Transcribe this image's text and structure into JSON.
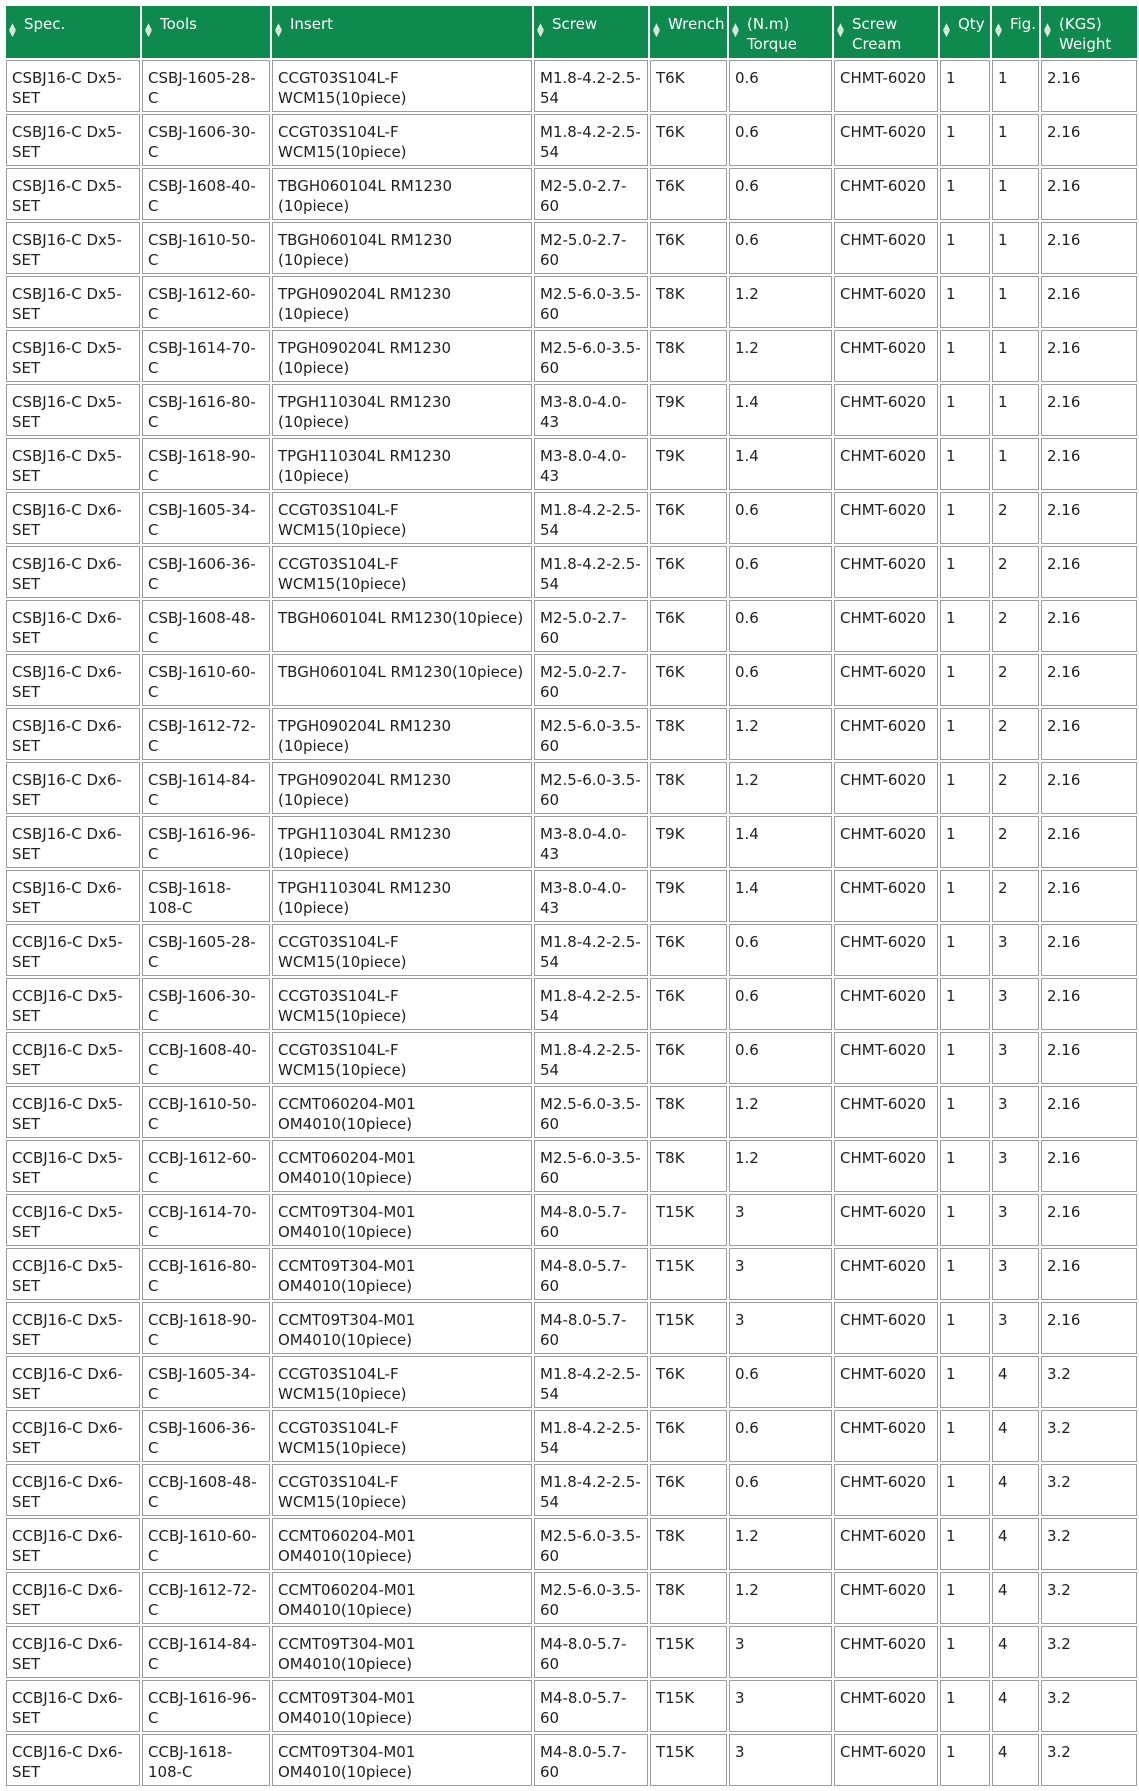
{
  "headers": [
    {
      "l1": "Spec.",
      "l2": ""
    },
    {
      "l1": "Tools",
      "l2": ""
    },
    {
      "l1": "Insert",
      "l2": ""
    },
    {
      "l1": "Screw",
      "l2": ""
    },
    {
      "l1": "Wrench",
      "l2": ""
    },
    {
      "l1": "(N.m)",
      "l2": "Torque"
    },
    {
      "l1": "Screw",
      "l2": "Cream"
    },
    {
      "l1": "Qty",
      "l2": ""
    },
    {
      "l1": "Fig.",
      "l2": ""
    },
    {
      "l1": "(KGS)",
      "l2": "Weight"
    }
  ],
  "rows": [
    [
      "CSBJ16-C Dx5-SET",
      "CSBJ-1605-28-C",
      "CCGT03S104L-F WCM15(10piece)",
      "M1.8-4.2-2.5-54",
      "T6K",
      "0.6",
      "CHMT-6020",
      "1",
      "1",
      "2.16"
    ],
    [
      "CSBJ16-C Dx5-SET",
      "CSBJ-1606-30-C",
      "CCGT03S104L-F WCM15(10piece)",
      "M1.8-4.2-2.5-54",
      "T6K",
      "0.6",
      "CHMT-6020",
      "1",
      "1",
      "2.16"
    ],
    [
      "CSBJ16-C Dx5-SET",
      "CSBJ-1608-40-C",
      "TBGH060104L RM1230 (10piece)",
      "M2-5.0-2.7-60",
      "T6K",
      "0.6",
      "CHMT-6020",
      "1",
      "1",
      "2.16"
    ],
    [
      "CSBJ16-C Dx5-SET",
      "CSBJ-1610-50-C",
      "TBGH060104L RM1230 (10piece)",
      "M2-5.0-2.7-60",
      "T6K",
      "0.6",
      "CHMT-6020",
      "1",
      "1",
      "2.16"
    ],
    [
      "CSBJ16-C Dx5-SET",
      "CSBJ-1612-60-C",
      "TPGH090204L RM1230 (10piece)",
      "M2.5-6.0-3.5-60",
      "T8K",
      "1.2",
      "CHMT-6020",
      "1",
      "1",
      "2.16"
    ],
    [
      "CSBJ16-C Dx5-SET",
      "CSBJ-1614-70-C",
      "TPGH090204L RM1230 (10piece)",
      "M2.5-6.0-3.5-60",
      "T8K",
      "1.2",
      "CHMT-6020",
      "1",
      "1",
      "2.16"
    ],
    [
      "CSBJ16-C Dx5-SET",
      "CSBJ-1616-80-C",
      "TPGH110304L RM1230 (10piece)",
      "M3-8.0-4.0-43",
      "T9K",
      "1.4",
      "CHMT-6020",
      "1",
      "1",
      "2.16"
    ],
    [
      "CSBJ16-C Dx5-SET",
      "CSBJ-1618-90-C",
      "TPGH110304L RM1230 (10piece)",
      "M3-8.0-4.0-43",
      "T9K",
      "1.4",
      "CHMT-6020",
      "1",
      "1",
      "2.16"
    ],
    [
      "CSBJ16-C Dx6-SET",
      "CSBJ-1605-34-C",
      "CCGT03S104L-F WCM15(10piece)",
      "M1.8-4.2-2.5-54",
      "T6K",
      "0.6",
      "CHMT-6020",
      "1",
      "2",
      "2.16"
    ],
    [
      "CSBJ16-C Dx6-SET",
      "CSBJ-1606-36-C",
      "CCGT03S104L-F WCM15(10piece)",
      "M1.8-4.2-2.5-54",
      "T6K",
      "0.6",
      "CHMT-6020",
      "1",
      "2",
      "2.16"
    ],
    [
      "CSBJ16-C Dx6-SET",
      "CSBJ-1608-48-C",
      "TBGH060104L RM1230(10piece)",
      "M2-5.0-2.7-60",
      "T6K",
      "0.6",
      "CHMT-6020",
      "1",
      "2",
      "2.16"
    ],
    [
      "CSBJ16-C Dx6-SET",
      "CSBJ-1610-60-C",
      "TBGH060104L RM1230(10piece)",
      "M2-5.0-2.7-60",
      "T6K",
      "0.6",
      "CHMT-6020",
      "1",
      "2",
      "2.16"
    ],
    [
      "CSBJ16-C Dx6-SET",
      "CSBJ-1612-72-C",
      "TPGH090204L RM1230 (10piece)",
      "M2.5-6.0-3.5-60",
      "T8K",
      "1.2",
      "CHMT-6020",
      "1",
      "2",
      "2.16"
    ],
    [
      "CSBJ16-C Dx6-SET",
      "CSBJ-1614-84-C",
      "TPGH090204L RM1230 (10piece)",
      "M2.5-6.0-3.5-60",
      "T8K",
      "1.2",
      "CHMT-6020",
      "1",
      "2",
      "2.16"
    ],
    [
      "CSBJ16-C Dx6-SET",
      "CSBJ-1616-96-C",
      "TPGH110304L RM1230 (10piece)",
      "M3-8.0-4.0-43",
      "T9K",
      "1.4",
      "CHMT-6020",
      "1",
      "2",
      "2.16"
    ],
    [
      "CSBJ16-C Dx6-SET",
      "CSBJ-1618-108-C",
      "TPGH110304L RM1230 (10piece)",
      "M3-8.0-4.0-43",
      "T9K",
      "1.4",
      "CHMT-6020",
      "1",
      "2",
      "2.16"
    ],
    [
      "CCBJ16-C Dx5-SET",
      "CSBJ-1605-28-C",
      "CCGT03S104L-F WCM15(10piece)",
      "M1.8-4.2-2.5-54",
      "T6K",
      "0.6",
      "CHMT-6020",
      "1",
      "3",
      "2.16"
    ],
    [
      "CCBJ16-C Dx5-SET",
      "CSBJ-1606-30-C",
      "CCGT03S104L-F WCM15(10piece)",
      "M1.8-4.2-2.5-54",
      "T6K",
      "0.6",
      "CHMT-6020",
      "1",
      "3",
      "2.16"
    ],
    [
      "CCBJ16-C Dx5-SET",
      "CCBJ-1608-40-C",
      "CCGT03S104L-F WCM15(10piece)",
      "M1.8-4.2-2.5-54",
      "T6K",
      "0.6",
      "CHMT-6020",
      "1",
      "3",
      "2.16"
    ],
    [
      "CCBJ16-C Dx5-SET",
      "CCBJ-1610-50-C",
      "CCMT060204-M01 OM4010(10piece)",
      "M2.5-6.0-3.5-60",
      "T8K",
      "1.2",
      "CHMT-6020",
      "1",
      "3",
      "2.16"
    ],
    [
      "CCBJ16-C Dx5-SET",
      "CCBJ-1612-60-C",
      "CCMT060204-M01 OM4010(10piece)",
      "M2.5-6.0-3.5-60",
      "T8K",
      "1.2",
      "CHMT-6020",
      "1",
      "3",
      "2.16"
    ],
    [
      "CCBJ16-C Dx5-SET",
      "CCBJ-1614-70-C",
      "CCMT09T304-M01 OM4010(10piece)",
      "M4-8.0-5.7-60",
      "T15K",
      "3",
      "CHMT-6020",
      "1",
      "3",
      "2.16"
    ],
    [
      "CCBJ16-C Dx5-SET",
      "CCBJ-1616-80-C",
      "CCMT09T304-M01 OM4010(10piece)",
      "M4-8.0-5.7-60",
      "T15K",
      "3",
      "CHMT-6020",
      "1",
      "3",
      "2.16"
    ],
    [
      "CCBJ16-C Dx5-SET",
      "CCBJ-1618-90-C",
      "CCMT09T304-M01 OM4010(10piece)",
      "M4-8.0-5.7-60",
      "T15K",
      "3",
      "CHMT-6020",
      "1",
      "3",
      "2.16"
    ],
    [
      "CCBJ16-C Dx6-SET",
      "CSBJ-1605-34-C",
      "CCGT03S104L-F WCM15(10piece)",
      "M1.8-4.2-2.5-54",
      "T6K",
      "0.6",
      "CHMT-6020",
      "1",
      "4",
      "3.2"
    ],
    [
      "CCBJ16-C Dx6-SET",
      "CSBJ-1606-36-C",
      "CCGT03S104L-F WCM15(10piece)",
      "M1.8-4.2-2.5-54",
      "T6K",
      "0.6",
      "CHMT-6020",
      "1",
      "4",
      "3.2"
    ],
    [
      "CCBJ16-C Dx6-SET",
      "CCBJ-1608-48-C",
      "CCGT03S104L-F WCM15(10piece)",
      "M1.8-4.2-2.5-54",
      "T6K",
      "0.6",
      "CHMT-6020",
      "1",
      "4",
      "3.2"
    ],
    [
      "CCBJ16-C Dx6-SET",
      "CCBJ-1610-60-C",
      "CCMT060204-M01 OM4010(10piece)",
      "M2.5-6.0-3.5-60",
      "T8K",
      "1.2",
      "CHMT-6020",
      "1",
      "4",
      "3.2"
    ],
    [
      "CCBJ16-C Dx6-SET",
      "CCBJ-1612-72-C",
      "CCMT060204-M01 OM4010(10piece)",
      "M2.5-6.0-3.5-60",
      "T8K",
      "1.2",
      "CHMT-6020",
      "1",
      "4",
      "3.2"
    ],
    [
      "CCBJ16-C Dx6-SET",
      "CCBJ-1614-84-C",
      "CCMT09T304-M01 OM4010(10piece)",
      "M4-8.0-5.7-60",
      "T15K",
      "3",
      "CHMT-6020",
      "1",
      "4",
      "3.2"
    ],
    [
      "CCBJ16-C Dx6-SET",
      "CCBJ-1616-96-C",
      "CCMT09T304-M01 OM4010(10piece)",
      "M4-8.0-5.7-60",
      "T15K",
      "3",
      "CHMT-6020",
      "1",
      "4",
      "3.2"
    ],
    [
      "CCBJ16-C Dx6-SET",
      "CCBJ-1618-108-C",
      "CCMT09T304-M01 OM4010(10piece)",
      "M4-8.0-5.7-60",
      "T15K",
      "3",
      "CHMT-6020",
      "1",
      "4",
      "3.2"
    ]
  ]
}
